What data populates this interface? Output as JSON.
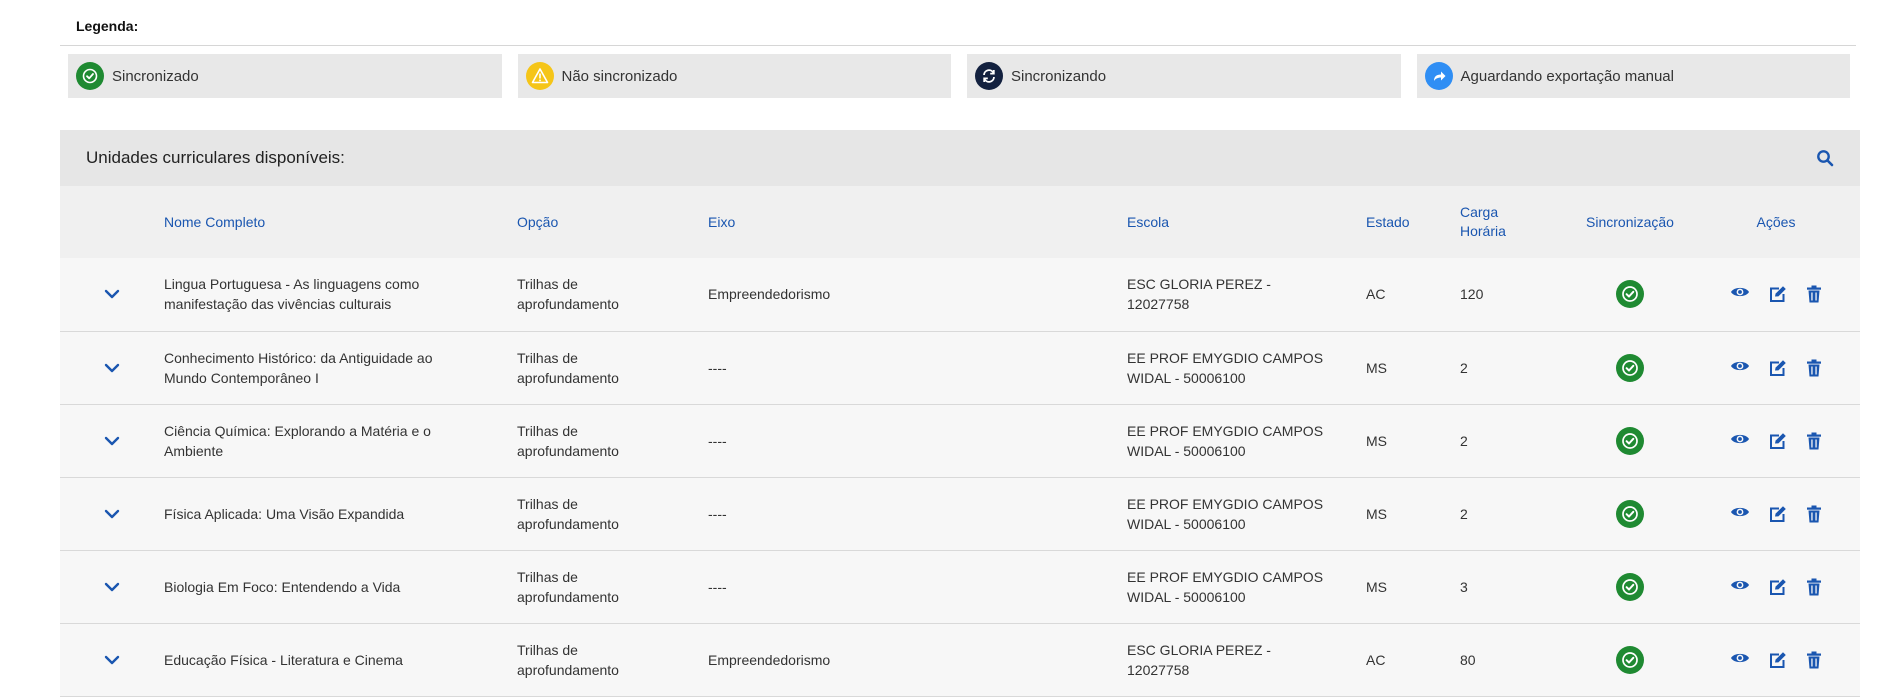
{
  "legend": {
    "title": "Legenda:",
    "items": [
      {
        "label": "Sincronizado",
        "icon": "check-circle-icon",
        "color": "#1f8a32"
      },
      {
        "label": "Não sincronizado",
        "icon": "warning-icon",
        "color": "#f5c518"
      },
      {
        "label": "Sincronizando",
        "icon": "sync-icon",
        "color": "#13213f"
      },
      {
        "label": "Aguardando exportação manual",
        "icon": "share-arrow-icon",
        "color": "#2f8ef4"
      }
    ]
  },
  "panel": {
    "title": "Unidades curriculares disponíveis:",
    "search_icon": "search-icon",
    "accent_color": "#1a56b0"
  },
  "table": {
    "columns": {
      "nome": "Nome Completo",
      "opcao": "Opção",
      "eixo": "Eixo",
      "escola": "Escola",
      "estado": "Estado",
      "carga_1": "Carga",
      "carga_2": "Horária",
      "sincronizacao": "Sincronização",
      "acoes": "Ações"
    },
    "rows": [
      {
        "nome": [
          "Lingua Portuguesa - As linguagens como",
          "manifestação das vivências culturais"
        ],
        "opcao": [
          "Trilhas de",
          "aprofundamento"
        ],
        "eixo": "Empreendedorismo",
        "escola": [
          "ESC GLORIA PEREZ -",
          "12027758"
        ],
        "estado": "AC",
        "carga": "120"
      },
      {
        "nome": [
          "Conhecimento Histórico: da Antiguidade ao",
          "Mundo Contemporâneo I"
        ],
        "opcao": [
          "Trilhas de",
          "aprofundamento"
        ],
        "eixo": "----",
        "escola": [
          "EE PROF EMYGDIO CAMPOS",
          "WIDAL - 50006100"
        ],
        "estado": "MS",
        "carga": "2"
      },
      {
        "nome": [
          "Ciência Química: Explorando a Matéria e o",
          "Ambiente"
        ],
        "opcao": [
          "Trilhas de",
          "aprofundamento"
        ],
        "eixo": "----",
        "escola": [
          "EE PROF EMYGDIO CAMPOS",
          "WIDAL - 50006100"
        ],
        "estado": "MS",
        "carga": "2"
      },
      {
        "nome": [
          "Física Aplicada: Uma Visão Expandida",
          ""
        ],
        "opcao": [
          "Trilhas de",
          "aprofundamento"
        ],
        "eixo": "----",
        "escola": [
          "EE PROF EMYGDIO CAMPOS",
          "WIDAL - 50006100"
        ],
        "estado": "MS",
        "carga": "2"
      },
      {
        "nome": [
          "Biologia Em Foco: Entendendo a Vida",
          ""
        ],
        "opcao": [
          "Trilhas de",
          "aprofundamento"
        ],
        "eixo": "----",
        "escola": [
          "EE PROF EMYGDIO CAMPOS",
          "WIDAL - 50006100"
        ],
        "estado": "MS",
        "carga": "3"
      },
      {
        "nome": [
          "Educação Física - Literatura e Cinema",
          ""
        ],
        "opcao": [
          "Trilhas de",
          "aprofundamento"
        ],
        "eixo": "Empreendedorismo",
        "escola": [
          "ESC GLORIA PEREZ -",
          "12027758"
        ],
        "estado": "AC",
        "carga": "80"
      }
    ]
  }
}
